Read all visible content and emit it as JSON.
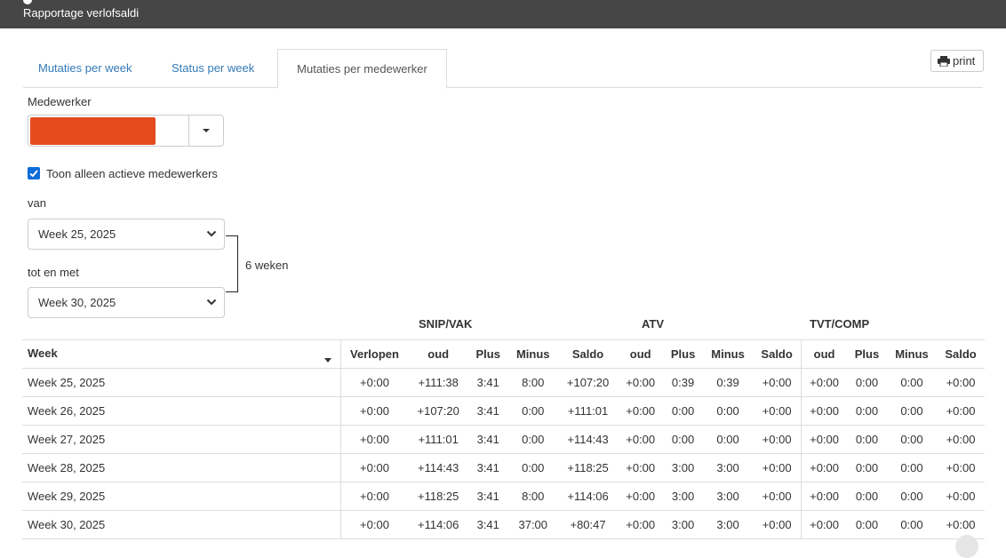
{
  "header": {
    "title": "Rapportage verlofsaldi"
  },
  "tabs": [
    {
      "label": "Mutaties per week",
      "active": false
    },
    {
      "label": "Status per week",
      "active": false
    },
    {
      "label": "Mutaties per medewerker",
      "active": true
    }
  ],
  "print": {
    "label": "print",
    "icon": "printer-icon"
  },
  "employee": {
    "label": "Medewerker",
    "selected_color": "#e54b1d"
  },
  "active_only": {
    "label": "Toon alleen actieve medewerkers",
    "checked": true
  },
  "range": {
    "from_label": "van",
    "from_value": "Week 25, 2025",
    "to_label": "tot en met",
    "to_value": "Week 30, 2025",
    "span": "6 weken"
  },
  "groups": [
    "SNIP/VAK",
    "ATV",
    "TVT/COMP"
  ],
  "columns": [
    "Week",
    "Verlopen",
    "oud",
    "Plus",
    "Minus",
    "Saldo",
    "oud",
    "Plus",
    "Minus",
    "Saldo",
    "oud",
    "Plus",
    "Minus",
    "Saldo"
  ],
  "rows": [
    [
      "Week 25, 2025",
      "+0:00",
      "+111:38",
      "3:41",
      "8:00",
      "+107:20",
      "+0:00",
      "0:39",
      "0:39",
      "+0:00",
      "+0:00",
      "0:00",
      "0:00",
      "+0:00"
    ],
    [
      "Week 26, 2025",
      "+0:00",
      "+107:20",
      "3:41",
      "0:00",
      "+111:01",
      "+0:00",
      "0:00",
      "0:00",
      "+0:00",
      "+0:00",
      "0:00",
      "0:00",
      "+0:00"
    ],
    [
      "Week 27, 2025",
      "+0:00",
      "+111:01",
      "3:41",
      "0:00",
      "+114:43",
      "+0:00",
      "0:00",
      "0:00",
      "+0:00",
      "+0:00",
      "0:00",
      "0:00",
      "+0:00"
    ],
    [
      "Week 28, 2025",
      "+0:00",
      "+114:43",
      "3:41",
      "0:00",
      "+118:25",
      "+0:00",
      "3:00",
      "3:00",
      "+0:00",
      "+0:00",
      "0:00",
      "0:00",
      "+0:00"
    ],
    [
      "Week 29, 2025",
      "+0:00",
      "+118:25",
      "3:41",
      "8:00",
      "+114:06",
      "+0:00",
      "3:00",
      "3:00",
      "+0:00",
      "+0:00",
      "0:00",
      "0:00",
      "+0:00"
    ],
    [
      "Week 30, 2025",
      "+0:00",
      "+114:06",
      "3:41",
      "37:00",
      "+80:47",
      "+0:00",
      "3:00",
      "3:00",
      "+0:00",
      "+0:00",
      "0:00",
      "0:00",
      "+0:00"
    ]
  ]
}
